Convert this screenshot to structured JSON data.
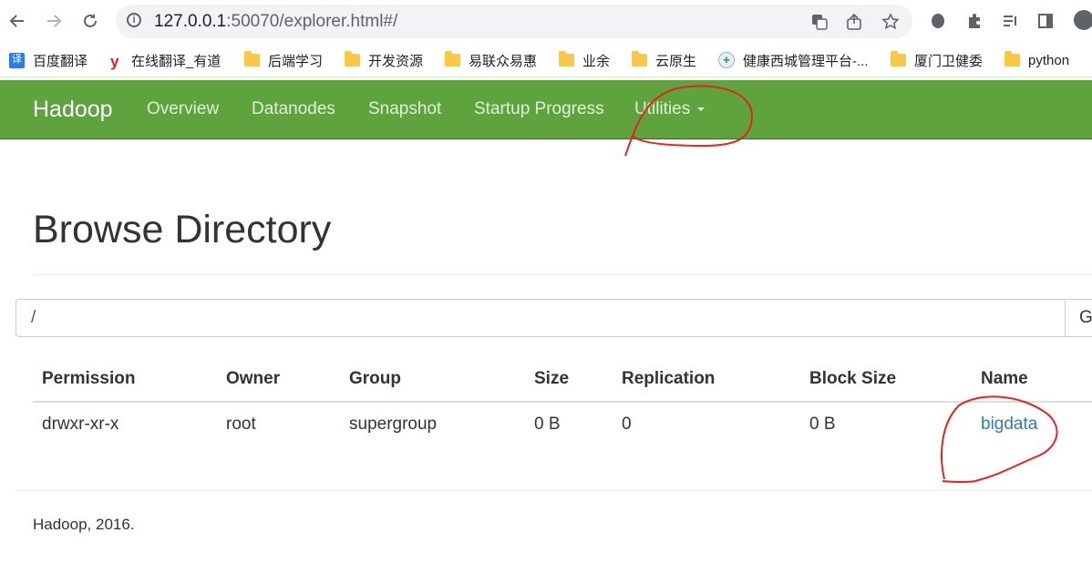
{
  "browser": {
    "url_host": "127.0.0.1",
    "url_path": ":50070/explorer.html#/",
    "icons": [
      "back-arrow-icon",
      "forward-arrow-icon",
      "reload-icon",
      "site-info-icon",
      "translate-icon",
      "share-icon",
      "bookmark-star-icon",
      "evernote-icon",
      "extensions-puzzle-icon",
      "media-queue-icon",
      "side-panel-icon",
      "profile-avatar-icon"
    ],
    "bookmarks": [
      {
        "label": "百度翻译",
        "icon": "baidu-translate-icon"
      },
      {
        "label": "在线翻译_有道",
        "icon": "youdao-icon"
      },
      {
        "label": "后端学习",
        "icon": "folder-icon"
      },
      {
        "label": "开发资源",
        "icon": "folder-icon"
      },
      {
        "label": "易联众易惠",
        "icon": "folder-icon"
      },
      {
        "label": "业余",
        "icon": "folder-icon"
      },
      {
        "label": "云原生",
        "icon": "folder-icon"
      },
      {
        "label": "健康西城管理平台-...",
        "icon": "site-badge-icon"
      },
      {
        "label": "厦门卫健委",
        "icon": "folder-icon"
      },
      {
        "label": "python",
        "icon": "folder-icon"
      }
    ]
  },
  "navbar": {
    "brand": "Hadoop",
    "items": [
      "Overview",
      "Datanodes",
      "Snapshot",
      "Startup Progress",
      "Utilities"
    ],
    "color": "#5fa33e"
  },
  "main": {
    "title": "Browse Directory",
    "path_value": "/",
    "go_label": "G",
    "columns": [
      "Permission",
      "Owner",
      "Group",
      "Size",
      "Replication",
      "Block Size",
      "Name"
    ],
    "rows": [
      {
        "permission": "drwxr-xr-x",
        "owner": "root",
        "group": "supergroup",
        "size": "0 B",
        "replication": "0",
        "block_size": "0 B",
        "name": "bigdata"
      }
    ],
    "link_color": "#337ab7"
  },
  "footer": {
    "text": "Hadoop, 2016."
  },
  "annotations": {
    "color": "#e8231f",
    "marks": [
      "circle-around-utilities",
      "circle-around-bigdata"
    ]
  }
}
